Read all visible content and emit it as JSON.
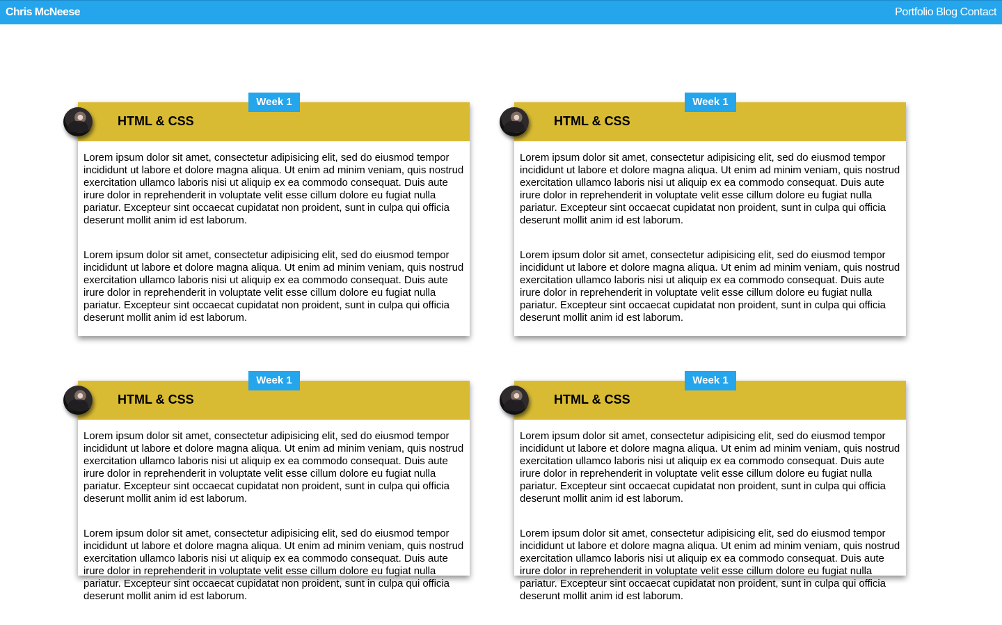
{
  "header": {
    "brand": "Chris McNeese",
    "nav": [
      "Portfolio",
      "Blog",
      "Contact"
    ]
  },
  "cards": [
    {
      "badge": "Week 1",
      "title": "HTML & CSS",
      "paragraphs": [
        "Lorem ipsum dolor sit amet, consectetur adipisicing elit, sed do eiusmod tempor incididunt ut labore et dolore magna aliqua. Ut enim ad minim veniam, quis nostrud exercitation ullamco laboris nisi ut aliquip ex ea commodo consequat. Duis aute irure dolor in reprehenderit in voluptate velit esse cillum dolore eu fugiat nulla pariatur. Excepteur sint occaecat cupidatat non proident, sunt in culpa qui officia deserunt mollit anim id est laborum.",
        "Lorem ipsum dolor sit amet, consectetur adipisicing elit, sed do eiusmod tempor incididunt ut labore et dolore magna aliqua. Ut enim ad minim veniam, quis nostrud exercitation ullamco laboris nisi ut aliquip ex ea commodo consequat. Duis aute irure dolor in reprehenderit in voluptate velit esse cillum dolore eu fugiat nulla pariatur. Excepteur sint occaecat cupidatat non proident, sunt in culpa qui officia deserunt mollit anim id est laborum."
      ]
    },
    {
      "badge": "Week 1",
      "title": "HTML & CSS",
      "paragraphs": [
        "Lorem ipsum dolor sit amet, consectetur adipisicing elit, sed do eiusmod tempor incididunt ut labore et dolore magna aliqua. Ut enim ad minim veniam, quis nostrud exercitation ullamco laboris nisi ut aliquip ex ea commodo consequat. Duis aute irure dolor in reprehenderit in voluptate velit esse cillum dolore eu fugiat nulla pariatur. Excepteur sint occaecat cupidatat non proident, sunt in culpa qui officia deserunt mollit anim id est laborum.",
        "Lorem ipsum dolor sit amet, consectetur adipisicing elit, sed do eiusmod tempor incididunt ut labore et dolore magna aliqua. Ut enim ad minim veniam, quis nostrud exercitation ullamco laboris nisi ut aliquip ex ea commodo consequat. Duis aute irure dolor in reprehenderit in voluptate velit esse cillum dolore eu fugiat nulla pariatur. Excepteur sint occaecat cupidatat non proident, sunt in culpa qui officia deserunt mollit anim id est laborum."
      ]
    },
    {
      "badge": "Week 1",
      "title": "HTML & CSS",
      "paragraphs": [
        "Lorem ipsum dolor sit amet, consectetur adipisicing elit, sed do eiusmod tempor incididunt ut labore et dolore magna aliqua. Ut enim ad minim veniam, quis nostrud exercitation ullamco laboris nisi ut aliquip ex ea commodo consequat. Duis aute irure dolor in reprehenderit in voluptate velit esse cillum dolore eu fugiat nulla pariatur. Excepteur sint occaecat cupidatat non proident, sunt in culpa qui officia deserunt mollit anim id est laborum.",
        "Lorem ipsum dolor sit amet, consectetur adipisicing elit, sed do eiusmod tempor incididunt ut labore et dolore magna aliqua. Ut enim ad minim veniam, quis nostrud exercitation ullamco laboris nisi ut aliquip ex ea commodo consequat. Duis aute irure dolor in reprehenderit in voluptate velit esse cillum dolore eu fugiat nulla pariatur. Excepteur sint occaecat cupidatat non proident, sunt in culpa qui officia deserunt mollit anim id est laborum."
      ]
    },
    {
      "badge": "Week 1",
      "title": "HTML & CSS",
      "paragraphs": [
        "Lorem ipsum dolor sit amet, consectetur adipisicing elit, sed do eiusmod tempor incididunt ut labore et dolore magna aliqua. Ut enim ad minim veniam, quis nostrud exercitation ullamco laboris nisi ut aliquip ex ea commodo consequat. Duis aute irure dolor in reprehenderit in voluptate velit esse cillum dolore eu fugiat nulla pariatur. Excepteur sint occaecat cupidatat non proident, sunt in culpa qui officia deserunt mollit anim id est laborum.",
        "Lorem ipsum dolor sit amet, consectetur adipisicing elit, sed do eiusmod tempor incididunt ut labore et dolore magna aliqua. Ut enim ad minim veniam, quis nostrud exercitation ullamco laboris nisi ut aliquip ex ea commodo consequat. Duis aute irure dolor in reprehenderit in voluptate velit esse cillum dolore eu fugiat nulla pariatur. Excepteur sint occaecat cupidatat non proident, sunt in culpa qui officia deserunt mollit anim id est laborum."
      ]
    }
  ],
  "colors": {
    "header_bg": "#24a5ec",
    "card_header_bg": "#d9bb33",
    "badge_bg": "#24a5ec"
  }
}
